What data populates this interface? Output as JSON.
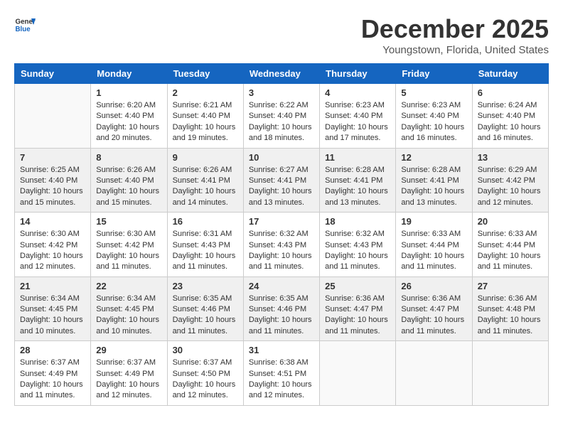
{
  "header": {
    "logo_general": "General",
    "logo_blue": "Blue",
    "month": "December 2025",
    "location": "Youngstown, Florida, United States"
  },
  "calendar": {
    "days_of_week": [
      "Sunday",
      "Monday",
      "Tuesday",
      "Wednesday",
      "Thursday",
      "Friday",
      "Saturday"
    ],
    "weeks": [
      [
        {
          "day": "",
          "info": ""
        },
        {
          "day": "1",
          "info": "Sunrise: 6:20 AM\nSunset: 4:40 PM\nDaylight: 10 hours\nand 20 minutes."
        },
        {
          "day": "2",
          "info": "Sunrise: 6:21 AM\nSunset: 4:40 PM\nDaylight: 10 hours\nand 19 minutes."
        },
        {
          "day": "3",
          "info": "Sunrise: 6:22 AM\nSunset: 4:40 PM\nDaylight: 10 hours\nand 18 minutes."
        },
        {
          "day": "4",
          "info": "Sunrise: 6:23 AM\nSunset: 4:40 PM\nDaylight: 10 hours\nand 17 minutes."
        },
        {
          "day": "5",
          "info": "Sunrise: 6:23 AM\nSunset: 4:40 PM\nDaylight: 10 hours\nand 16 minutes."
        },
        {
          "day": "6",
          "info": "Sunrise: 6:24 AM\nSunset: 4:40 PM\nDaylight: 10 hours\nand 16 minutes."
        }
      ],
      [
        {
          "day": "7",
          "info": "Sunrise: 6:25 AM\nSunset: 4:40 PM\nDaylight: 10 hours\nand 15 minutes."
        },
        {
          "day": "8",
          "info": "Sunrise: 6:26 AM\nSunset: 4:40 PM\nDaylight: 10 hours\nand 15 minutes."
        },
        {
          "day": "9",
          "info": "Sunrise: 6:26 AM\nSunset: 4:41 PM\nDaylight: 10 hours\nand 14 minutes."
        },
        {
          "day": "10",
          "info": "Sunrise: 6:27 AM\nSunset: 4:41 PM\nDaylight: 10 hours\nand 13 minutes."
        },
        {
          "day": "11",
          "info": "Sunrise: 6:28 AM\nSunset: 4:41 PM\nDaylight: 10 hours\nand 13 minutes."
        },
        {
          "day": "12",
          "info": "Sunrise: 6:28 AM\nSunset: 4:41 PM\nDaylight: 10 hours\nand 13 minutes."
        },
        {
          "day": "13",
          "info": "Sunrise: 6:29 AM\nSunset: 4:42 PM\nDaylight: 10 hours\nand 12 minutes."
        }
      ],
      [
        {
          "day": "14",
          "info": "Sunrise: 6:30 AM\nSunset: 4:42 PM\nDaylight: 10 hours\nand 12 minutes."
        },
        {
          "day": "15",
          "info": "Sunrise: 6:30 AM\nSunset: 4:42 PM\nDaylight: 10 hours\nand 11 minutes."
        },
        {
          "day": "16",
          "info": "Sunrise: 6:31 AM\nSunset: 4:43 PM\nDaylight: 10 hours\nand 11 minutes."
        },
        {
          "day": "17",
          "info": "Sunrise: 6:32 AM\nSunset: 4:43 PM\nDaylight: 10 hours\nand 11 minutes."
        },
        {
          "day": "18",
          "info": "Sunrise: 6:32 AM\nSunset: 4:43 PM\nDaylight: 10 hours\nand 11 minutes."
        },
        {
          "day": "19",
          "info": "Sunrise: 6:33 AM\nSunset: 4:44 PM\nDaylight: 10 hours\nand 11 minutes."
        },
        {
          "day": "20",
          "info": "Sunrise: 6:33 AM\nSunset: 4:44 PM\nDaylight: 10 hours\nand 11 minutes."
        }
      ],
      [
        {
          "day": "21",
          "info": "Sunrise: 6:34 AM\nSunset: 4:45 PM\nDaylight: 10 hours\nand 10 minutes."
        },
        {
          "day": "22",
          "info": "Sunrise: 6:34 AM\nSunset: 4:45 PM\nDaylight: 10 hours\nand 10 minutes."
        },
        {
          "day": "23",
          "info": "Sunrise: 6:35 AM\nSunset: 4:46 PM\nDaylight: 10 hours\nand 11 minutes."
        },
        {
          "day": "24",
          "info": "Sunrise: 6:35 AM\nSunset: 4:46 PM\nDaylight: 10 hours\nand 11 minutes."
        },
        {
          "day": "25",
          "info": "Sunrise: 6:36 AM\nSunset: 4:47 PM\nDaylight: 10 hours\nand 11 minutes."
        },
        {
          "day": "26",
          "info": "Sunrise: 6:36 AM\nSunset: 4:47 PM\nDaylight: 10 hours\nand 11 minutes."
        },
        {
          "day": "27",
          "info": "Sunrise: 6:36 AM\nSunset: 4:48 PM\nDaylight: 10 hours\nand 11 minutes."
        }
      ],
      [
        {
          "day": "28",
          "info": "Sunrise: 6:37 AM\nSunset: 4:49 PM\nDaylight: 10 hours\nand 11 minutes."
        },
        {
          "day": "29",
          "info": "Sunrise: 6:37 AM\nSunset: 4:49 PM\nDaylight: 10 hours\nand 12 minutes."
        },
        {
          "day": "30",
          "info": "Sunrise: 6:37 AM\nSunset: 4:50 PM\nDaylight: 10 hours\nand 12 minutes."
        },
        {
          "day": "31",
          "info": "Sunrise: 6:38 AM\nSunset: 4:51 PM\nDaylight: 10 hours\nand 12 minutes."
        },
        {
          "day": "",
          "info": ""
        },
        {
          "day": "",
          "info": ""
        },
        {
          "day": "",
          "info": ""
        }
      ]
    ]
  }
}
